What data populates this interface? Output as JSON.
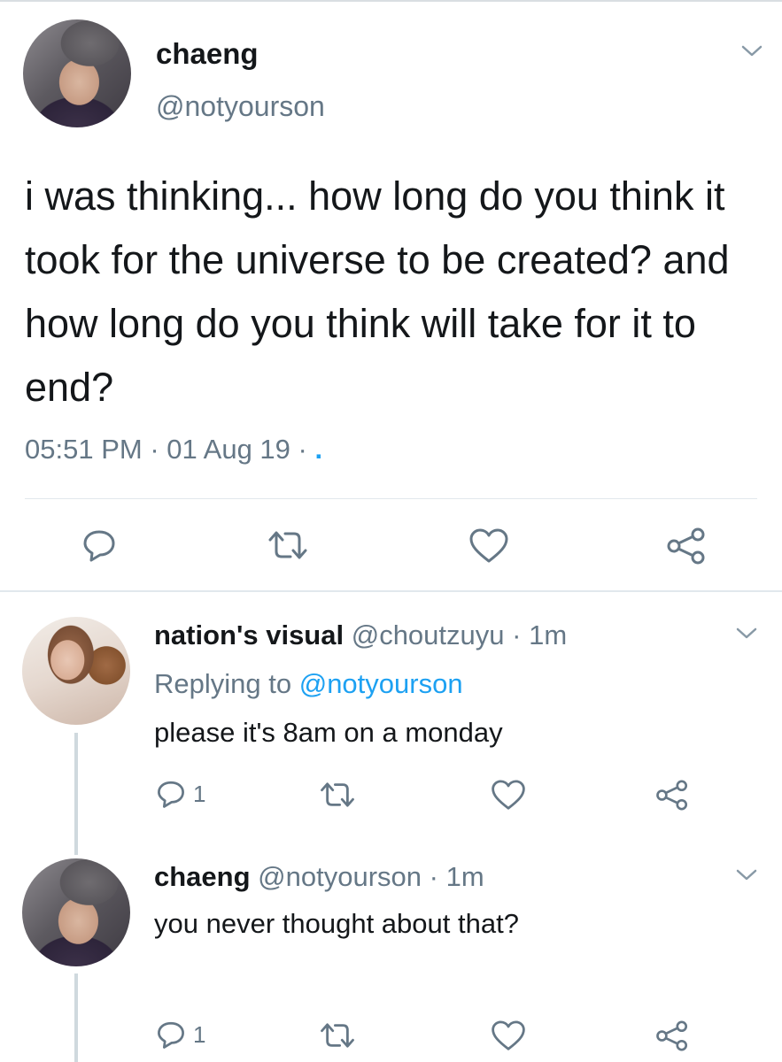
{
  "main_tweet": {
    "author_name": "chaeng",
    "author_handle": "@notyourson",
    "text": "i was thinking... how long do you think it took for the universe to be created? and how long do you think will take for it to end?",
    "time": "05:51 PM",
    "date": "01 Aug 19",
    "separator": "·",
    "trailing": "."
  },
  "replies": [
    {
      "author_name": "nation's visual",
      "author_handle": "@choutzuyu",
      "time_ago": "1m",
      "replying_prefix": "Replying to",
      "replying_to": "@notyourson",
      "text": "please it's 8am on a monday",
      "reply_count": "1"
    },
    {
      "author_name": "chaeng",
      "author_handle": "@notyourson",
      "time_ago": "1m",
      "text": "you never thought about that?",
      "reply_count": "1"
    }
  ],
  "colors": {
    "text": "#14171a",
    "secondary": "#657786",
    "accent": "#1da1f2",
    "divider": "#e1e8ed"
  },
  "icons": [
    "chevron-down-icon",
    "reply-icon",
    "retweet-icon",
    "like-icon",
    "share-icon"
  ]
}
